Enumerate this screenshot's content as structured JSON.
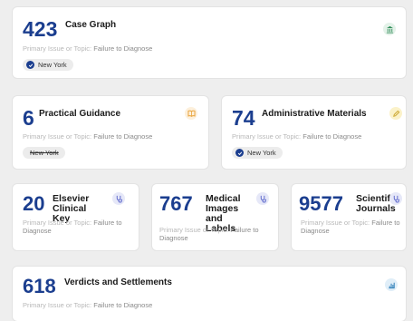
{
  "cards": [
    {
      "count": "423",
      "title": "Case Graph",
      "topic_label": "Primary Issue or Topic:",
      "topic_value": "Failure to Diagnose",
      "pill": "New York",
      "pill_state": "checked",
      "icon": "bank-icon",
      "icon_color": "#2e8b57"
    },
    {
      "count": "6",
      "title": "Practical Guidance",
      "topic_label": "Primary Issue or Topic:",
      "topic_value": "Failure to Diagnose",
      "pill": "New York",
      "pill_state": "struck",
      "icon": "book-icon",
      "icon_color": "#e8a33a"
    },
    {
      "count": "74",
      "title": "Administrative Materials",
      "topic_label": "Primary Issue or Topic:",
      "topic_value": "Failure to Diagnose",
      "pill": "New York",
      "pill_state": "checked",
      "icon": "pencil-icon",
      "icon_color": "#c9a227"
    },
    {
      "count": "20",
      "title": "Elsevier Clinical Key",
      "topic_label": "Primary Issue or Topic:",
      "topic_value": "Failure to Diagnose",
      "icon": "stethoscope-icon",
      "icon_color": "#5560c8"
    },
    {
      "count": "767",
      "title": "Medical Images and Labels",
      "topic_label": "Primary Issue or Topic:",
      "topic_value": "Failure to Diagnose",
      "icon": "stethoscope-icon",
      "icon_color": "#5560c8"
    },
    {
      "count": "9577",
      "title": "Scientific Journals",
      "topic_label": "Primary Issue or Topic:",
      "topic_value": "Failure to Diagnose",
      "icon": "stethoscope-icon",
      "icon_color": "#5560c8"
    },
    {
      "count": "618",
      "title": "Verdicts and Settlements",
      "topic_label": "Primary Issue or Topic:",
      "topic_value": "Failure to Diagnose",
      "icon": "chart-icon",
      "icon_color": "#2e7fb8"
    }
  ]
}
